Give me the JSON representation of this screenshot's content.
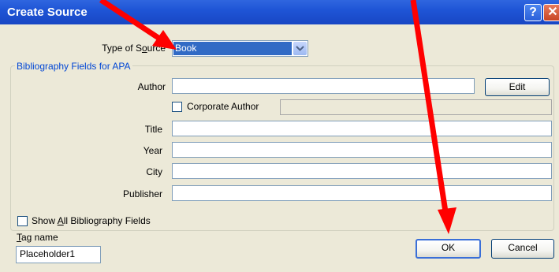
{
  "window": {
    "title": "Create Source",
    "help_glyph": "?",
    "close_glyph": "✕"
  },
  "source_type": {
    "label_pre": "Type of S",
    "label_accel": "o",
    "label_post": "urce",
    "value": "Book"
  },
  "group": {
    "legend": "Bibliography Fields for APA"
  },
  "fields": {
    "author": {
      "label": "Author",
      "value": ""
    },
    "edit_button": "Edit",
    "corporate_author": {
      "label": "Corporate Author",
      "checked": false,
      "value": ""
    },
    "title": {
      "label": "Title",
      "value": ""
    },
    "year": {
      "label": "Year",
      "value": ""
    },
    "city": {
      "label": "City",
      "value": ""
    },
    "publisher": {
      "label": "Publisher",
      "value": ""
    }
  },
  "show_all": {
    "label_pre": "Show ",
    "label_accel": "A",
    "label_post": "ll Bibliography Fields",
    "checked": false
  },
  "tag": {
    "label_accel": "T",
    "label_post": "ag name",
    "value": "Placeholder1"
  },
  "buttons": {
    "ok": "OK",
    "cancel": "Cancel"
  },
  "colors": {
    "titlebar": "#1f55d6",
    "dialog_bg": "#ece9d8",
    "selection": "#316ac5",
    "annotation_arrow": "#ff0000",
    "group_legend": "#0046d5"
  }
}
